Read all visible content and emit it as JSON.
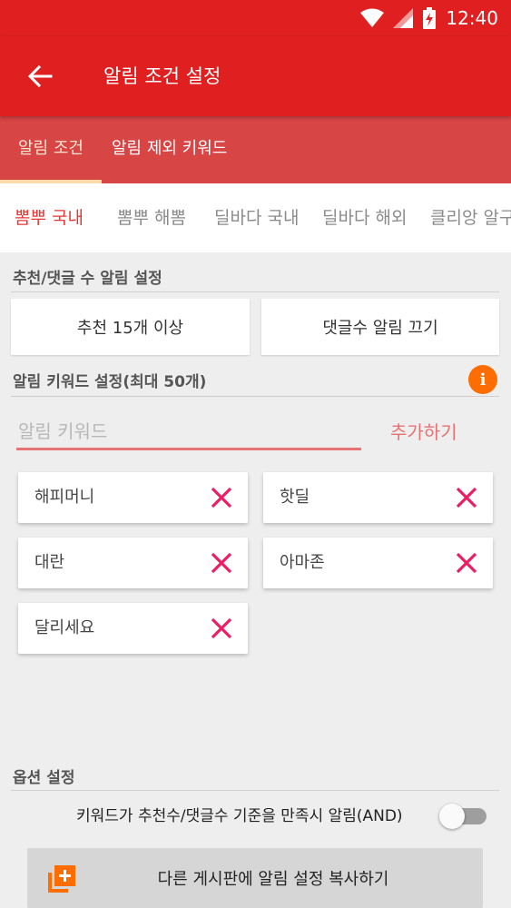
{
  "status_bar": {
    "time": "12:40",
    "icons": [
      "wifi-icon",
      "cell-signal-icon",
      "battery-charging-icon"
    ]
  },
  "app_bar": {
    "title": "알림 조건 설정",
    "back_icon": "arrow-left-icon"
  },
  "tabs": [
    {
      "label": "알림 조건",
      "active": true
    },
    {
      "label": "알림 제외 키워드",
      "active": false
    }
  ],
  "board_tabs": [
    {
      "label": "뽐뿌 국내",
      "active": true
    },
    {
      "label": "뽐뿌 해뽐",
      "active": false
    },
    {
      "label": "딜바다 국내",
      "active": false
    },
    {
      "label": "딜바다 해외",
      "active": false
    },
    {
      "label": "클리앙 알구",
      "active": false
    }
  ],
  "recommend_section": {
    "title": "추천/댓글 수 알림 설정",
    "recommend_value": "추천 15개 이상",
    "comment_value": "댓글수 알림 끄기"
  },
  "keyword_section": {
    "title": "알림 키워드 설정(최대 50개)",
    "info_icon": "info-icon",
    "input_placeholder": "알림 키워드",
    "input_value": "",
    "add_label": "추가하기",
    "keywords": [
      "해피머니",
      "핫딜",
      "대란",
      "아마존",
      "달리세요"
    ]
  },
  "option_section": {
    "title": "옵션 설정",
    "and_option_label": "키워드가 추천수/댓글수 기준을 만족시 알림(AND)",
    "and_option_enabled": false
  },
  "copy_button": {
    "label": "다른 게시판에 알림 설정 복사하기",
    "icon": "copy-add-icon"
  },
  "colors": {
    "primary": "#e02020",
    "tab_bar": "#d84545",
    "accent": "#e53935",
    "chip_x": "#e91e63",
    "info": "#ff6d00"
  }
}
